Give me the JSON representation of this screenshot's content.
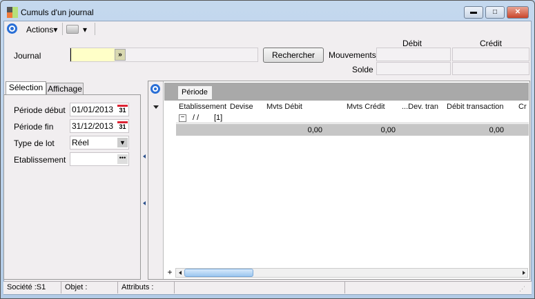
{
  "window": {
    "title": "Cumuls d'un journal",
    "minimize": "▬",
    "maximize": "□",
    "close": "✕"
  },
  "toolbar": {
    "actions_label": "Actions▾",
    "print_dropdown": "▾"
  },
  "search": {
    "journal_label": "Journal",
    "journal_value": "",
    "rechercher_label": "Rechercher"
  },
  "totals": {
    "debit_header": "Débit",
    "credit_header": "Crédit",
    "mouvements_label": "Mouvements",
    "solde_label": "Solde"
  },
  "tabs": [
    {
      "label": "Sélection",
      "active": true
    },
    {
      "label": "Affichage",
      "active": false
    }
  ],
  "selection": {
    "periode_debut_label": "Période début",
    "periode_debut_value": "01/01/2013",
    "periode_fin_label": "Période fin",
    "periode_fin_value": "31/12/2013",
    "type_lot_label": "Type de lot",
    "type_lot_value": "Réel",
    "etablissement_label": "Etablissement",
    "etablissement_value": "",
    "calendar_text": "31"
  },
  "grid": {
    "group_chip": "Période",
    "columns": [
      "Etablissement",
      "Devise",
      "Mvts Débit",
      "Mvts Crédit",
      "...Dev. tran",
      "Débit transaction",
      "Cr"
    ],
    "group_row": {
      "toggle": "−",
      "label": "/ /",
      "count": "[1]"
    },
    "summary": {
      "mvts_debit": "0,00",
      "mvts_credit": "0,00",
      "debit_transaction": "0,00"
    }
  },
  "status": {
    "societe": "Société :S1",
    "objet": "Objet :",
    "attributs": "Attributs :"
  },
  "colors": {
    "accent": "#2a6fd6",
    "journal_bg": "#ffffc8",
    "group_bar": "#a9a9a9",
    "summary_row": "#c6c6c6"
  }
}
